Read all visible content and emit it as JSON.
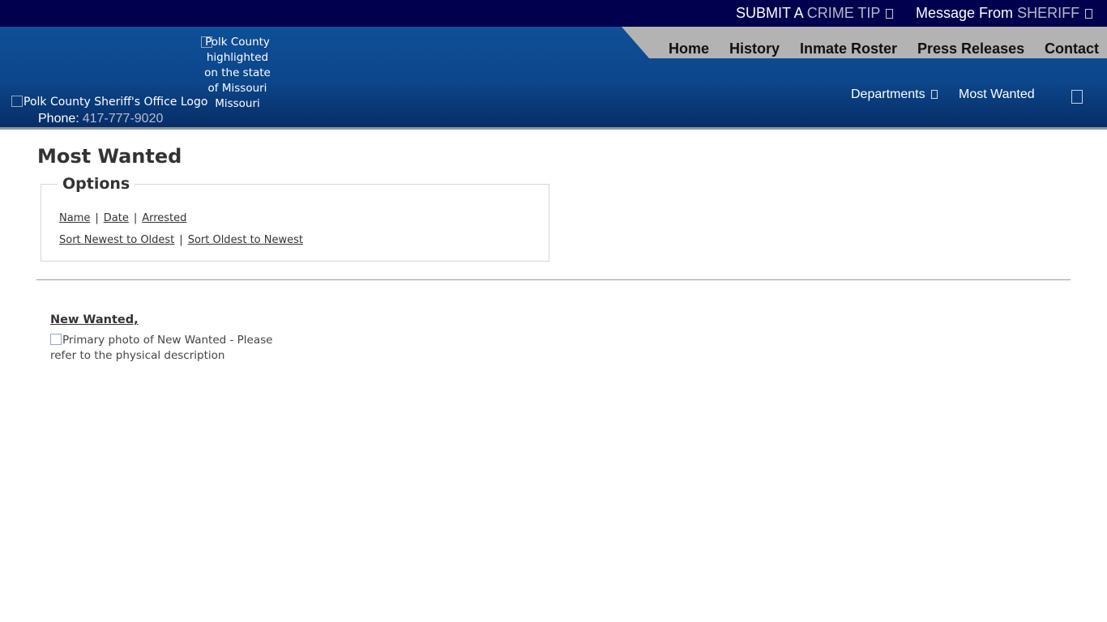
{
  "topbar": {
    "crime_tip": {
      "part1": "SUBMIT A",
      "part2": "CRIME TIP"
    },
    "sheriff_message": {
      "part1": "Message From",
      "part2": "SHERIFF"
    }
  },
  "header": {
    "logo_alt": "Polk County Sheriff's Office Logo",
    "phone_label": "Phone:",
    "phone_number": "417-777-9020",
    "map_alt": "Polk County highlighted on the state of Missouri",
    "map_caption": "Missouri"
  },
  "primary_nav": [
    "Home",
    "History",
    "Inmate Roster",
    "Press Releases",
    "Contact"
  ],
  "secondary_nav": {
    "departments": "Departments",
    "most_wanted": "Most Wanted"
  },
  "page": {
    "title": "Most Wanted",
    "options_legend": "Options",
    "filter_links": [
      "Name",
      "Date",
      "Arrested"
    ],
    "sort_links": [
      "Sort Newest to Oldest",
      "Sort Oldest to Newest"
    ],
    "separator": "|"
  },
  "wanted_entry": {
    "name": "New Wanted,",
    "photo_alt": "Primary photo of New Wanted - Please refer to the physical description"
  },
  "colors": {
    "topbar_bg": "#00004f",
    "header_bg_top": "#0f4f97",
    "header_bg_bottom": "#072d66",
    "nav_bg": "#b3b3b3"
  }
}
